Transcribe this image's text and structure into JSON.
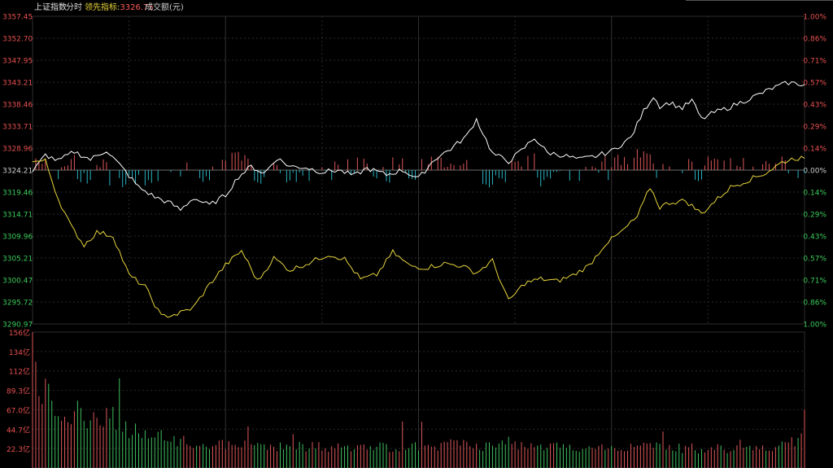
{
  "header": {
    "index_name": "上证指数",
    "mode": "分时",
    "leading_label": "领先指标:",
    "leading_value": "3326.75",
    "volume_label": "成交额(元)"
  },
  "colors": {
    "up": "#e0575a",
    "down": "#2ab4c4",
    "price_line": "#ffffff",
    "leading_line": "#e8d53c",
    "volume_up": "#e0575a",
    "volume_down": "#3fbf5f",
    "grid": "#2a2a2a"
  },
  "chart_data": [
    {
      "type": "line",
      "title": "上证指数 分时",
      "ylim": [
        3290.97,
        3357.45
      ],
      "prev_close": 3324.21,
      "left_ticks": [
        "3357.45",
        "3352.70",
        "3347.95",
        "3343.21",
        "3338.46",
        "3333.71",
        "3328.96",
        "3324.21",
        "3319.46",
        "3314.71",
        "3309.96",
        "3305.21",
        "3300.47",
        "3295.72",
        "3290.97"
      ],
      "right_ticks": [
        "1.00%",
        "0.86%",
        "0.71%",
        "0.57%",
        "0.43%",
        "0.29%",
        "0.14%",
        "0.00%",
        "0.14%",
        "0.29%",
        "0.43%",
        "0.57%",
        "0.71%",
        "0.86%",
        "1.00%"
      ],
      "x_count": 241,
      "series": [
        {
          "name": "上证指数",
          "anchors": [
            [
              0,
              3323.8
            ],
            [
              4,
              3327.5
            ],
            [
              8,
              3326.2
            ],
            [
              13,
              3328.2
            ],
            [
              18,
              3326.5
            ],
            [
              23,
              3328.5
            ],
            [
              28,
              3324.6
            ],
            [
              33,
              3320.5
            ],
            [
              38,
              3318.4
            ],
            [
              43,
              3317.0
            ],
            [
              46,
              3315.6
            ],
            [
              50,
              3318.2
            ],
            [
              55,
              3316.6
            ],
            [
              60,
              3318.8
            ],
            [
              64,
              3322.8
            ],
            [
              68,
              3325.0
            ],
            [
              72,
              3323.5
            ],
            [
              76,
              3326.8
            ],
            [
              80,
              3325.0
            ],
            [
              85,
              3324.8
            ],
            [
              90,
              3323.8
            ],
            [
              95,
              3324.2
            ],
            [
              100,
              3323.0
            ],
            [
              104,
              3324.6
            ],
            [
              110,
              3323.2
            ],
            [
              115,
              3324.2
            ],
            [
              120,
              3322.4
            ],
            [
              125,
              3326.6
            ],
            [
              130,
              3328.8
            ],
            [
              135,
              3331.6
            ],
            [
              138,
              3335.2
            ],
            [
              143,
              3327.8
            ],
            [
              148,
              3326.1
            ],
            [
              152,
              3328.4
            ],
            [
              156,
              3331.2
            ],
            [
              160,
              3328.0
            ],
            [
              165,
              3327.4
            ],
            [
              170,
              3326.5
            ],
            [
              175,
              3327.2
            ],
            [
              180,
              3328.3
            ],
            [
              186,
              3331.2
            ],
            [
              190,
              3337.0
            ],
            [
              193,
              3340.2
            ],
            [
              195,
              3338.0
            ],
            [
              198,
              3338.8
            ],
            [
              202,
              3337.6
            ],
            [
              205,
              3339.3
            ],
            [
              208,
              3335.2
            ],
            [
              212,
              3336.7
            ],
            [
              216,
              3337.6
            ],
            [
              220,
              3338.8
            ],
            [
              225,
              3340.3
            ],
            [
              230,
              3341.9
            ],
            [
              235,
              3343.1
            ],
            [
              240,
              3342.7
            ]
          ]
        },
        {
          "name": "领先指标",
          "anchors": [
            [
              0,
              3326.0
            ],
            [
              4,
              3326.2
            ],
            [
              8,
              3318.0
            ],
            [
              12,
              3312.0
            ],
            [
              16,
              3308.0
            ],
            [
              20,
              3310.8
            ],
            [
              25,
              3310.0
            ],
            [
              30,
              3301.5
            ],
            [
              35,
              3299.0
            ],
            [
              40,
              3292.6
            ],
            [
              45,
              3293.1
            ],
            [
              50,
              3294.5
            ],
            [
              55,
              3299.5
            ],
            [
              60,
              3303.7
            ],
            [
              65,
              3306.8
            ],
            [
              70,
              3300.2
            ],
            [
              75,
              3305.2
            ],
            [
              80,
              3302.6
            ],
            [
              86,
              3304.2
            ],
            [
              92,
              3306.0
            ],
            [
              97,
              3305.0
            ],
            [
              102,
              3300.6
            ],
            [
              107,
              3301.6
            ],
            [
              112,
              3306.5
            ],
            [
              117,
              3303.6
            ],
            [
              122,
              3303.1
            ],
            [
              128,
              3304.0
            ],
            [
              133,
              3303.6
            ],
            [
              138,
              3302.0
            ],
            [
              143,
              3304.6
            ],
            [
              148,
              3295.9
            ],
            [
              153,
              3299.8
            ],
            [
              158,
              3300.7
            ],
            [
              163,
              3300.2
            ],
            [
              168,
              3301.5
            ],
            [
              173,
              3303.6
            ],
            [
              178,
              3308.2
            ],
            [
              183,
              3310.8
            ],
            [
              188,
              3314.1
            ],
            [
              192,
              3320.5
            ],
            [
              195,
              3316.2
            ],
            [
              198,
              3317.2
            ],
            [
              203,
              3317.6
            ],
            [
              208,
              3314.8
            ],
            [
              212,
              3317.4
            ],
            [
              217,
              3320.5
            ],
            [
              222,
              3321.9
            ],
            [
              228,
              3323.6
            ],
            [
              233,
              3325.9
            ],
            [
              237,
              3326.8
            ],
            [
              240,
              3326.75
            ]
          ]
        }
      ]
    },
    {
      "type": "bar",
      "title": "成交额(元)",
      "ylim": [
        0,
        156
      ],
      "ticks": [
        "156亿",
        "134亿",
        "112亿",
        "89.3亿",
        "67.0亿",
        "44.7亿",
        "22.3亿"
      ],
      "x_count": 241,
      "series": [
        {
          "name": "成交额",
          "anchors": [
            [
              0,
              156
            ],
            [
              1,
              118
            ],
            [
              2,
              97
            ],
            [
              3,
              87
            ],
            [
              5,
              80
            ],
            [
              8,
              74
            ],
            [
              12,
              67
            ],
            [
              16,
              60
            ],
            [
              20,
              53
            ],
            [
              25,
              49
            ],
            [
              30,
              44
            ],
            [
              35,
              40
            ],
            [
              40,
              35
            ],
            [
              45,
              31
            ],
            [
              50,
              28
            ],
            [
              60,
              26
            ],
            [
              70,
              26
            ],
            [
              80,
              25
            ],
            [
              90,
              24
            ],
            [
              100,
              23
            ],
            [
              110,
              24
            ],
            [
              120,
              25
            ],
            [
              130,
              27
            ],
            [
              140,
              26
            ],
            [
              150,
              25
            ],
            [
              160,
              24
            ],
            [
              170,
              23
            ],
            [
              180,
              23
            ],
            [
              190,
              25
            ],
            [
              200,
              23
            ],
            [
              210,
              22
            ],
            [
              220,
              22
            ],
            [
              230,
              24
            ],
            [
              236,
              30
            ],
            [
              239,
              36
            ],
            [
              240,
              67
            ]
          ]
        }
      ]
    }
  ]
}
